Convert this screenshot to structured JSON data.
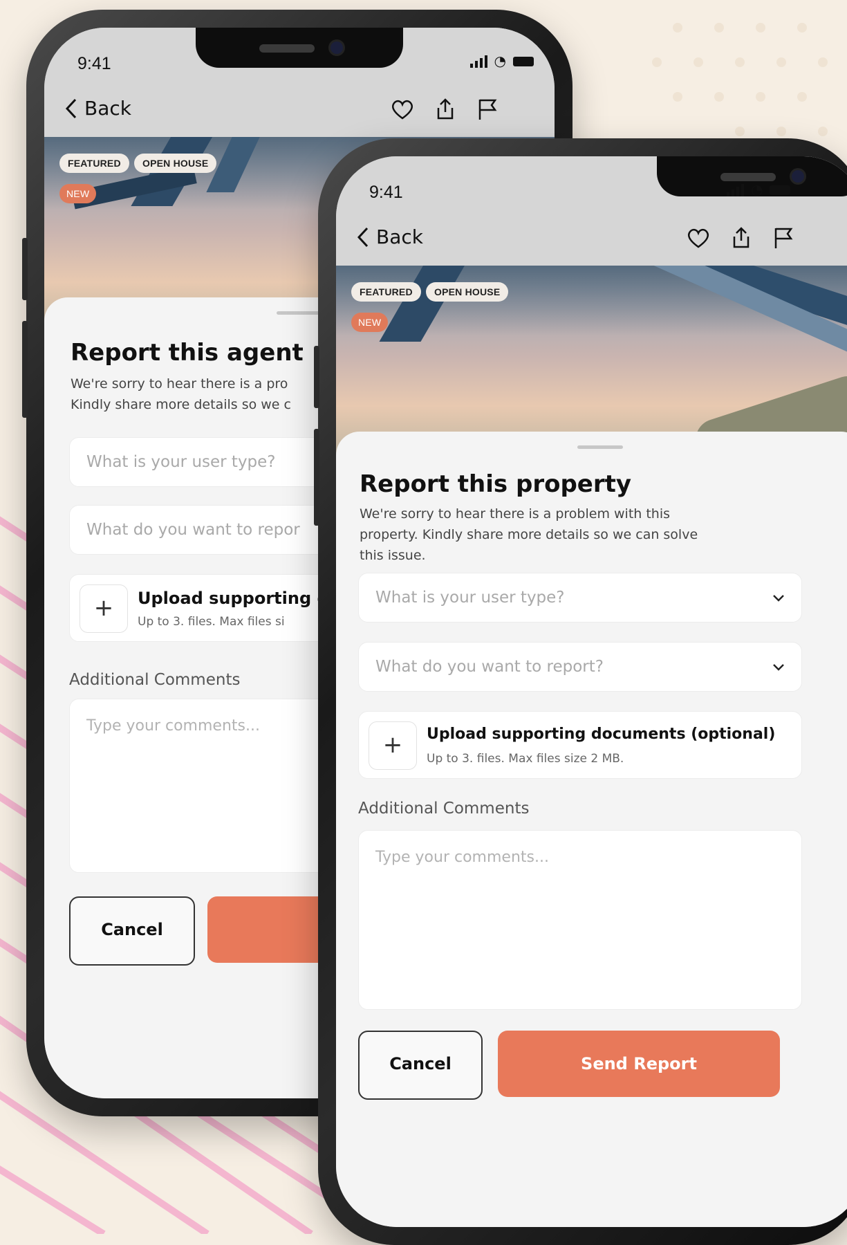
{
  "status": {
    "time": "9:41"
  },
  "nav": {
    "back_label": "Back"
  },
  "tags": {
    "featured": "FEATURED",
    "open_house": "OPEN HOUSE",
    "new": "NEW"
  },
  "back_screen": {
    "title": "Report this agent",
    "desc_line1": "We're sorry to hear there is a pro",
    "desc_line2": "Kindly share more details so we c",
    "user_type_placeholder": "What is your user type?",
    "report_placeholder": "What do you want to repor",
    "upload_title": "Upload supporting d",
    "upload_sub": "Up to 3. files. Max files si",
    "comments_label": "Additional Comments",
    "comments_placeholder": "Type your comments...",
    "cancel_label": "Cancel"
  },
  "front_screen": {
    "title": "Report this property",
    "desc_line1": "We're sorry to hear there is a problem with this",
    "desc_line2": "property. Kindly share more details so we can solve",
    "desc_line3": "this issue.",
    "user_type_placeholder": "What is your user type?",
    "report_placeholder": "What do you want to report?",
    "upload_title": "Upload supporting documents (optional)",
    "upload_sub": "Up to 3. files. Max files size 2 MB.",
    "comments_label": "Additional Comments",
    "comments_placeholder": "Type your comments...",
    "cancel_label": "Cancel",
    "send_label": "Send Report"
  },
  "colors": {
    "accent": "#e8795a",
    "background": "#f6eee3",
    "stripe": "#f4b6cf"
  }
}
